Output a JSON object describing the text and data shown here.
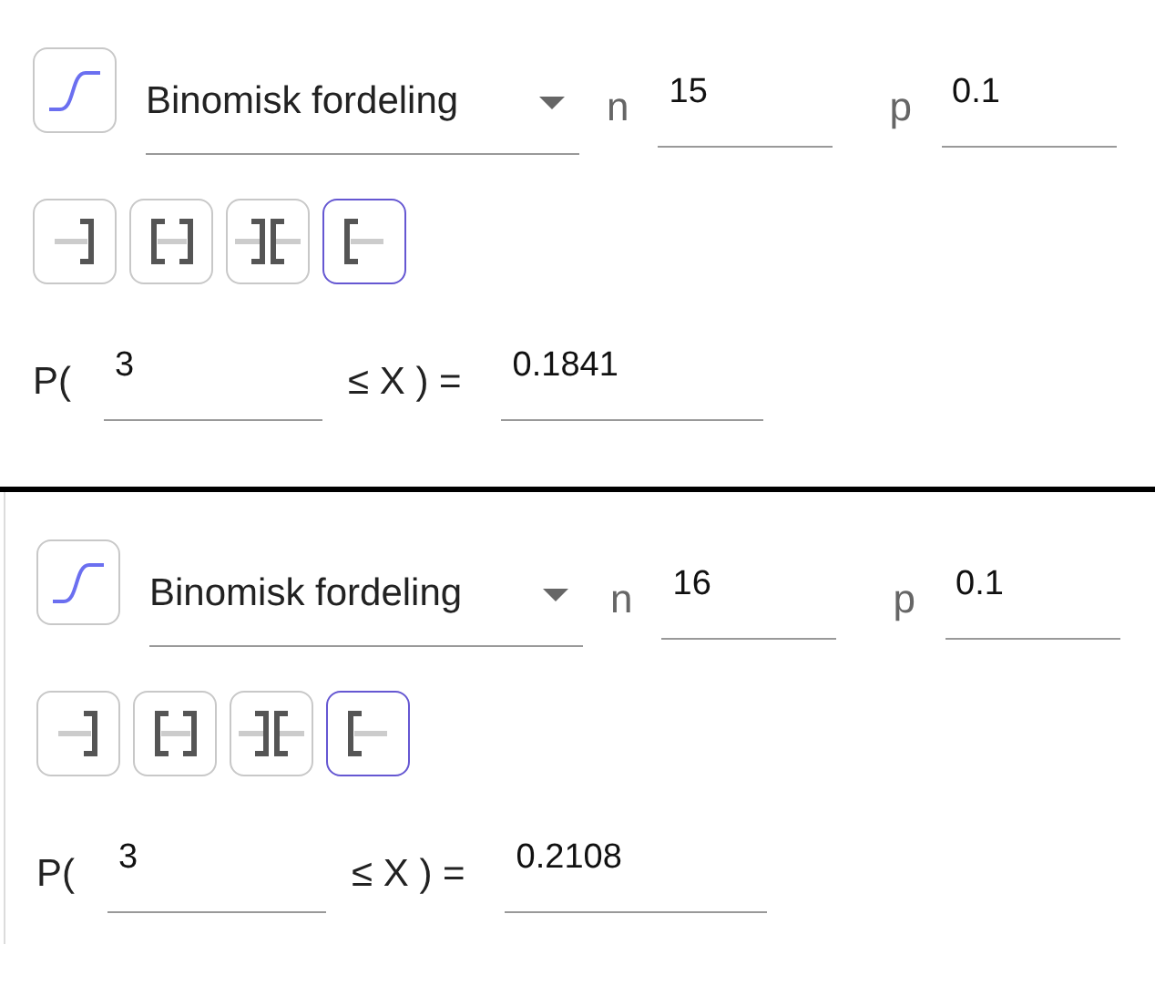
{
  "panels": [
    {
      "distribution": "Binomisk fordeling",
      "n_label": "n",
      "n": "15",
      "p_label": "p",
      "p": "0.1",
      "modes": [
        {
          "kind": "left",
          "selected": false
        },
        {
          "kind": "interval",
          "selected": false
        },
        {
          "kind": "two-tailed",
          "selected": false
        },
        {
          "kind": "right",
          "selected": true
        }
      ],
      "prefix": "P(",
      "lower": "3",
      "relation": "≤ X ) =",
      "result": "0.1841"
    },
    {
      "distribution": "Binomisk fordeling",
      "n_label": "n",
      "n": "16",
      "p_label": "p",
      "p": "0.1",
      "modes": [
        {
          "kind": "left",
          "selected": false
        },
        {
          "kind": "interval",
          "selected": false
        },
        {
          "kind": "two-tailed",
          "selected": false
        },
        {
          "kind": "right",
          "selected": true
        }
      ],
      "prefix": "P(",
      "lower": "3",
      "relation": "≤ X ) =",
      "result": "0.2108"
    }
  ]
}
